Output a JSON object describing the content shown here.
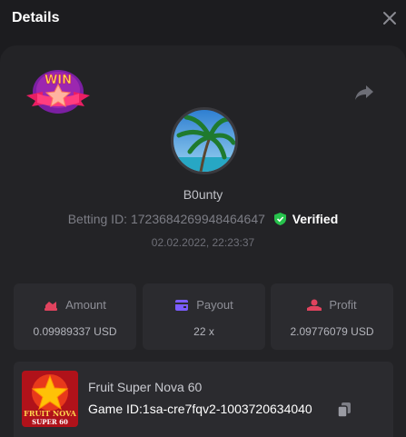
{
  "header": {
    "title": "Details"
  },
  "badge": {
    "text": "WIN"
  },
  "user": {
    "name": "B0unty",
    "betting_id_label": "Betting ID:",
    "betting_id": "1723684269948464647",
    "verified_label": "Verified",
    "date": "02.02.2022, 22:23:37"
  },
  "stats": {
    "amount": {
      "label": "Amount",
      "value": "0.09989337 USD"
    },
    "payout": {
      "label": "Payout",
      "value": "22 x"
    },
    "profit": {
      "label": "Profit",
      "value": "2.09776079 USD"
    }
  },
  "game": {
    "name": "Fruit Super Nova 60",
    "id_label": "Game ID:",
    "id": "1sa-cre7fqv2-1003720634040",
    "thumb_line1": "FRUIT NOVA",
    "thumb_line2": "SUPER 60"
  },
  "colors": {
    "background": "#1c1c1f",
    "panel": "#232326",
    "card": "#2b2b2f",
    "verified_green": "#27c24c",
    "amount_icon": "#e0435e",
    "payout_icon": "#7b5cff",
    "profit_icon": "#e0435e"
  }
}
